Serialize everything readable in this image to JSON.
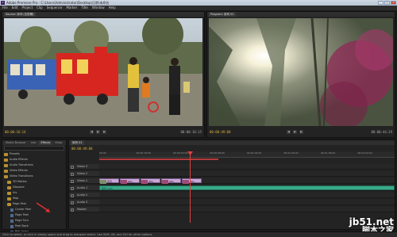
{
  "window": {
    "title": "Adobe Premiere Pro - C:\\Users\\Administrator\\Desktop\\日常\\未命名",
    "buttons": {
      "minimize": "–",
      "maximize": "□",
      "close": "×"
    }
  },
  "menubar": [
    "File",
    "Edit",
    "Project",
    "Clip",
    "Sequence",
    "Marker",
    "Title",
    "Window",
    "Help"
  ],
  "source_monitor": {
    "tab": "Source: 序列 (无剪辑)",
    "timecode_left": "00:00:16:14",
    "timecode_right": "00:00:16:15",
    "fit": "Fit"
  },
  "program_monitor": {
    "tab": "Program: 序列 01",
    "timecode_left": "00:00:49:08",
    "timecode_right": "00:00:44:29",
    "fit": "Fit"
  },
  "effects_panel": {
    "tabs": [
      "Media Browser",
      "Info",
      "Effects",
      "Histo"
    ],
    "active_tab": "Effects",
    "search_placeholder": "",
    "items": [
      {
        "label": "Presets",
        "kind": "folder",
        "indent": 0
      },
      {
        "label": "Audio Effects",
        "kind": "folder",
        "indent": 0
      },
      {
        "label": "Audio Transitions",
        "kind": "folder",
        "indent": 0
      },
      {
        "label": "Video Effects",
        "kind": "folder",
        "indent": 0
      },
      {
        "label": "Video Transitions",
        "kind": "folder",
        "indent": 0
      },
      {
        "label": "3D Motion",
        "kind": "folder",
        "indent": 1
      },
      {
        "label": "Dissolve",
        "kind": "folder",
        "indent": 1
      },
      {
        "label": "Iris",
        "kind": "folder",
        "indent": 1
      },
      {
        "label": "Map",
        "kind": "folder",
        "indent": 1
      },
      {
        "label": "Page Peel",
        "kind": "folder",
        "indent": 1
      },
      {
        "label": "Center Peel",
        "kind": "fx",
        "indent": 2
      },
      {
        "label": "Page Peel",
        "kind": "fx",
        "indent": 2
      },
      {
        "label": "Page Turn",
        "kind": "fx",
        "indent": 2
      },
      {
        "label": "Peel Back",
        "kind": "fx",
        "indent": 2
      },
      {
        "label": "Roll Away",
        "kind": "fx",
        "indent": 2
      },
      {
        "label": "Slide",
        "kind": "folder",
        "indent": 1
      },
      {
        "label": "Special Effect",
        "kind": "folder",
        "indent": 1
      }
    ]
  },
  "timeline": {
    "tab": "序列 01",
    "timecode": "00:00:49:08",
    "ruler": [
      "00:00",
      "00:00:16:00",
      "00:00:32:00",
      "00:00:48:00",
      "00:01:04:02",
      "00:01:20:02",
      "00:01:36:02",
      "00:01:52:02"
    ],
    "tracks": [
      {
        "name": "Video 3",
        "kind": "video"
      },
      {
        "name": "Video 2",
        "kind": "video"
      },
      {
        "name": "Video 1",
        "kind": "video"
      },
      {
        "name": "Audio 1",
        "kind": "audio"
      },
      {
        "name": "Audio 2",
        "kind": "audio"
      },
      {
        "name": "Audio 3",
        "kind": "audio"
      },
      {
        "name": "Master",
        "kind": "audio"
      }
    ],
    "video_clips": [
      "风景图.JPG",
      "IMG_",
      "IMG_",
      "IMG_",
      "IMG_"
    ],
    "audio_clip": "音乐.mp3"
  },
  "status": "Click to select, or click in empty space and drag to marquee select. Use Shift, Alt, and Ctrl for other options.",
  "watermark": {
    "line1": "jb51.net",
    "line2": "脚本之家"
  },
  "colors": {
    "timecode": "#e0b23c",
    "video_clip": "#c9a7d6",
    "audio_clip": "#3aa98a",
    "playhead": "#e04040"
  }
}
